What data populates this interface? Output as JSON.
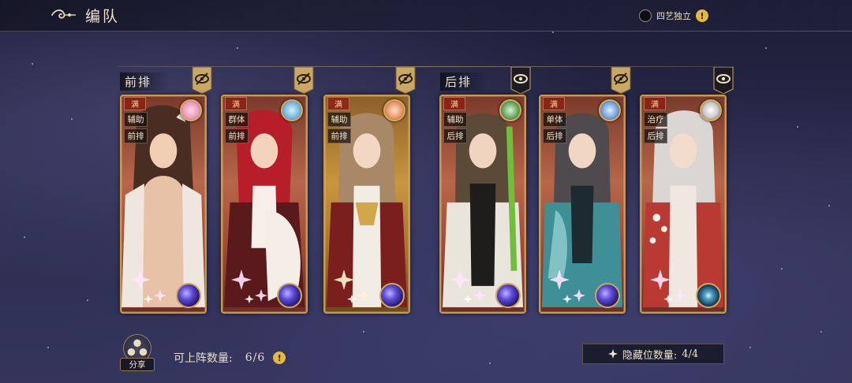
{
  "header": {
    "title": "编队",
    "toggle_label": "四艺独立",
    "info_glyph": "!"
  },
  "rows": {
    "front_label": "前排",
    "back_label": "后排"
  },
  "cards": [
    {
      "top_tag": "满",
      "role": "辅助",
      "position": "前排",
      "element_icon": "pink-bunny-icon",
      "orb": "purple-orb-icon",
      "frame": "red",
      "eye": "eye-hidden-icon"
    },
    {
      "top_tag": "满",
      "role": "群体",
      "position": "前排",
      "element_icon": "blue-wolf-icon",
      "orb": "purple-orb-icon",
      "frame": "red",
      "eye": "eye-hidden-icon"
    },
    {
      "top_tag": "满",
      "role": "辅助",
      "position": "前排",
      "element_icon": "fox-icon",
      "orb": "purple-orb-icon",
      "frame": "gold",
      "eye": "eye-hidden-icon"
    },
    {
      "top_tag": "满",
      "role": "辅助",
      "position": "后排",
      "element_icon": "green-bird-icon",
      "orb": "purple-orb-icon",
      "frame": "red",
      "eye": "eye-visible-icon"
    },
    {
      "top_tag": "满",
      "role": "单体",
      "position": "后排",
      "element_icon": "blue-dragon-icon",
      "orb": "purple-orb-icon",
      "frame": "red",
      "eye": "eye-hidden-icon"
    },
    {
      "top_tag": "满",
      "role": "治疗",
      "position": "后排",
      "element_icon": "white-bird-icon",
      "orb": "teal-eye-orb-icon",
      "frame": "red",
      "eye": "eye-visible-icon"
    }
  ],
  "footer": {
    "share_label": "分享",
    "deploy_label": "可上阵数量:",
    "deploy_value": "6/6",
    "hidden_label": "隐藏位数量:",
    "hidden_value": "4/4"
  },
  "colors": {
    "accent_gold": "#c69a4a",
    "info_yellow": "#e6b83c",
    "background": "#2a2b4d"
  }
}
